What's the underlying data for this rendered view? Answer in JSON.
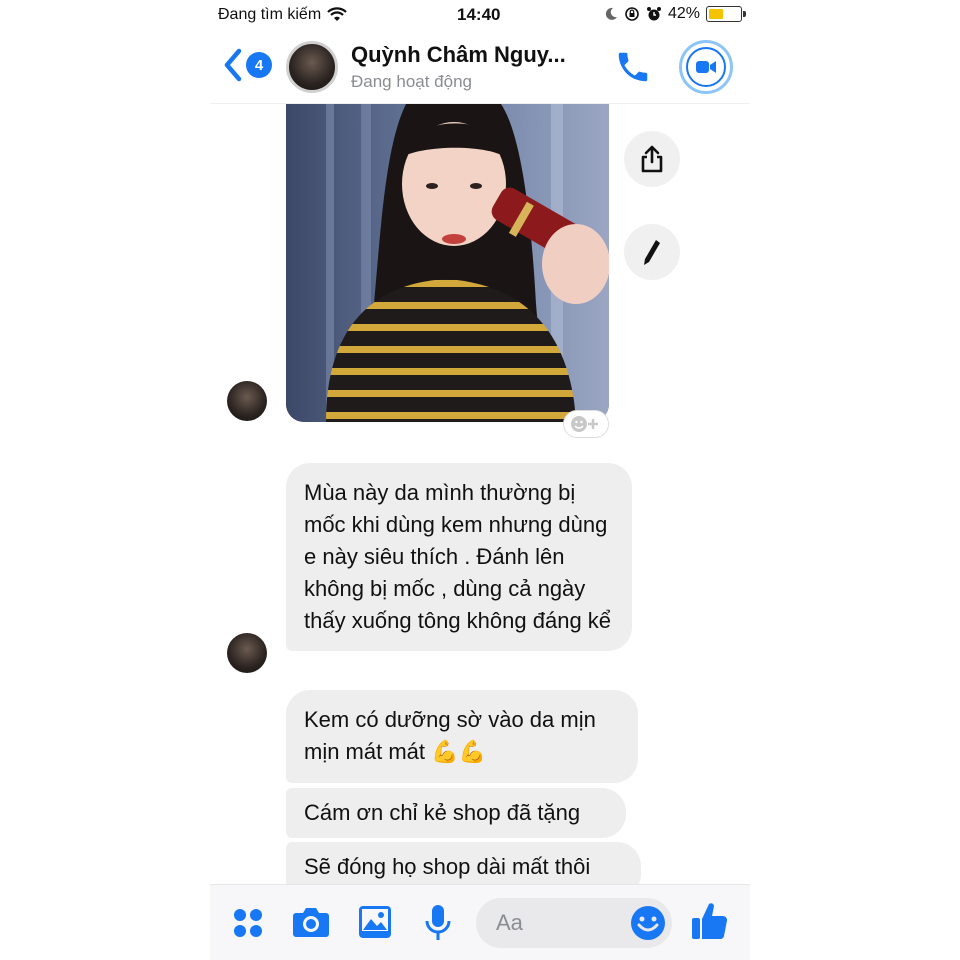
{
  "status_bar": {
    "carrier": "Đang tìm kiếm",
    "time": "14:40",
    "battery": "42%",
    "battery_level": 0.42
  },
  "header": {
    "back_badge": "4",
    "name": "Quỳnh Châm Nguy...",
    "status": "Đang hoạt động"
  },
  "messages": [
    {
      "type": "image",
      "icon": "photo"
    },
    {
      "type": "text",
      "text": "Mùa này da mình thường bị mốc khi dùng kem nhưng dùng e này siêu thích . Đánh lên không bị mốc , dùng cả ngày thấy xuống tông không đáng kể"
    },
    {
      "type": "text",
      "text": "Kem có dưỡng sờ vào da mịn mịn mát mát",
      "emoji": "💪💪"
    },
    {
      "type": "text",
      "text": "Cám ơn chỉ kẻ shop đã tặng"
    },
    {
      "type": "text",
      "text": "Sẽ đóng họ shop dài mất thôi"
    }
  ],
  "composer": {
    "placeholder": "Aa"
  },
  "colors": {
    "accent": "#1877f2",
    "bubble": "#eeeeee",
    "battery": "#f5c400"
  },
  "icons": [
    "wifi-icon",
    "moon-icon",
    "rotation-lock-icon",
    "alarm-icon",
    "back-icon",
    "phone-icon",
    "video-icon",
    "share-icon",
    "pencil-icon",
    "add-reaction-icon",
    "apps-icon",
    "camera-icon",
    "gallery-icon",
    "microphone-icon",
    "emoji-icon",
    "thumbs-up-icon"
  ]
}
